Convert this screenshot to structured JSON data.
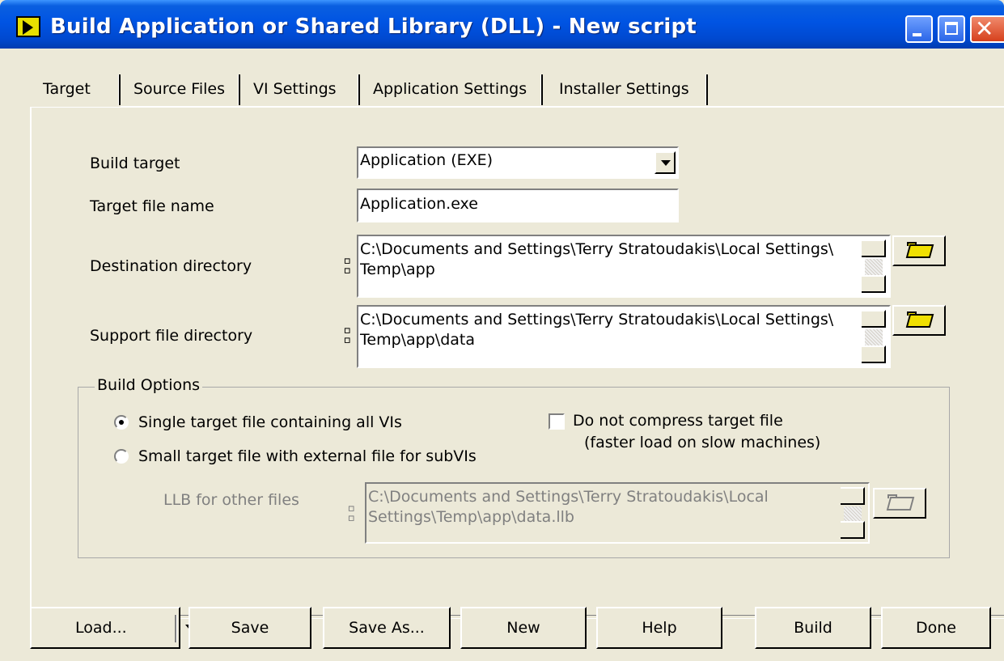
{
  "window": {
    "title": "Build Application or Shared Library (DLL) - New script",
    "controls": [
      "minimize-icon",
      "maximize-icon",
      "close-icon"
    ]
  },
  "tabs": [
    {
      "label": "Target",
      "active": true
    },
    {
      "label": "Source Files",
      "active": false
    },
    {
      "label": "VI Settings",
      "active": false
    },
    {
      "label": "Application Settings",
      "active": false
    },
    {
      "label": "Installer Settings",
      "active": false
    }
  ],
  "target": {
    "build_target_label": "Build target",
    "build_target_value": "Application (EXE)",
    "target_file_label": "Target file name",
    "target_file_value": "Application.exe",
    "destination_label": "Destination directory",
    "destination_value": "C:\\Documents and Settings\\Terry Stratoudakis\\Local Settings\\\nTemp\\app",
    "support_label": "Support file directory",
    "support_value": "C:\\Documents and Settings\\Terry Stratoudakis\\Local Settings\\\nTemp\\app\\data"
  },
  "build_options": {
    "title": "Build Options",
    "radio_single": "Single target file containing all VIs",
    "radio_small": "Small target file with external file for subVIs",
    "selected": "single",
    "checkbox_line1": "Do not compress target file",
    "checkbox_line2": "(faster load on slow machines)",
    "checkbox_checked": false,
    "llb_label": "LLB for other files",
    "llb_value": "C:\\Documents and Settings\\Terry Stratoudakis\\Local\nSettings\\Temp\\app\\data.llb"
  },
  "buttons": {
    "load": "Load...",
    "save": "Save",
    "save_as": "Save As...",
    "new": "New",
    "help": "Help",
    "build": "Build",
    "done": "Done"
  },
  "colors": {
    "titlebar": "#0054e3",
    "face": "#ece9d8",
    "folder": "#f0e000"
  }
}
